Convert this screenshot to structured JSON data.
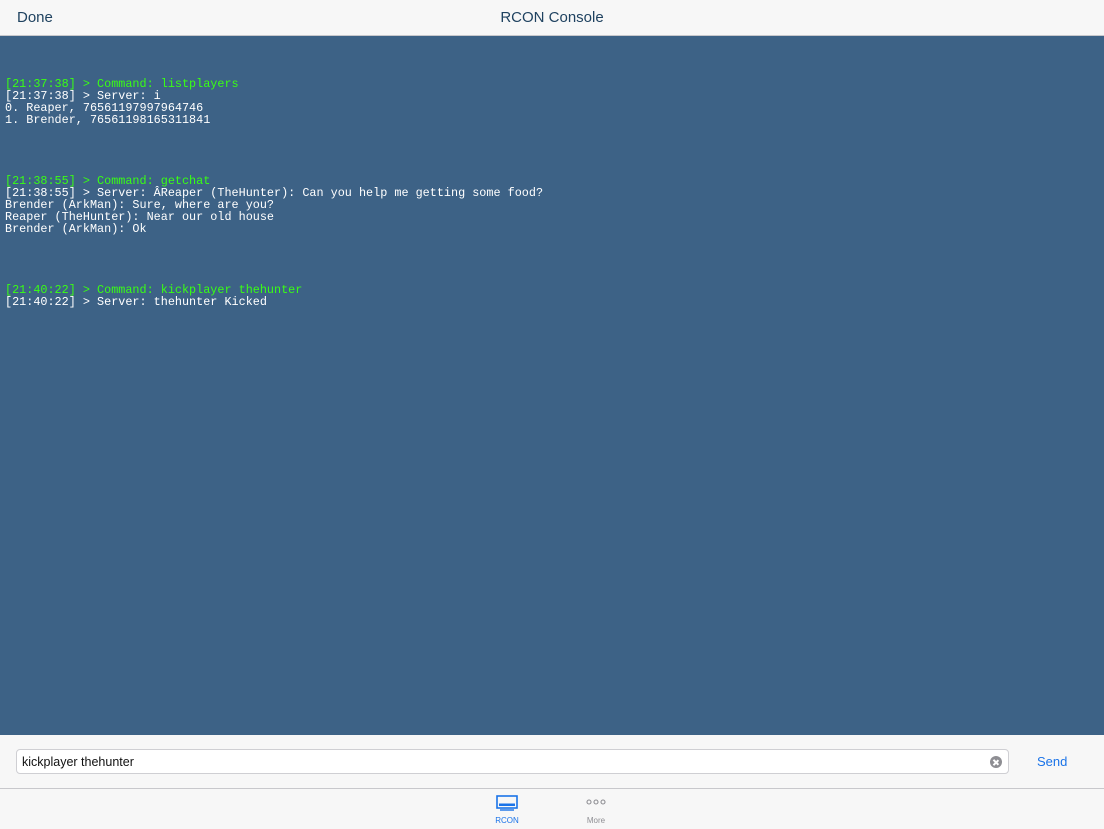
{
  "navbar": {
    "done_label": "Done",
    "title": "RCON Console"
  },
  "console": {
    "lines": [
      {
        "type": "blank",
        "text": ""
      },
      {
        "type": "command",
        "text": "[21:37:38] > Command: listplayers"
      },
      {
        "type": "server",
        "text": "[21:37:38] > Server: i"
      },
      {
        "type": "server",
        "text": "0. Reaper, 76561197997964746"
      },
      {
        "type": "server",
        "text": "1. Brender, 76561198165311841"
      },
      {
        "type": "blank",
        "text": ""
      },
      {
        "type": "blank",
        "text": ""
      },
      {
        "type": "blank",
        "text": ""
      },
      {
        "type": "blank",
        "text": ""
      },
      {
        "type": "command",
        "text": "[21:38:55] > Command: getchat"
      },
      {
        "type": "server",
        "text": "[21:38:55] > Server: ÂReaper (TheHunter): Can you help me getting some food?"
      },
      {
        "type": "server",
        "text": "Brender (ArkMan): Sure, where are you?"
      },
      {
        "type": "server",
        "text": "Reaper (TheHunter): Near our old house"
      },
      {
        "type": "server",
        "text": "Brender (ArkMan): Ok"
      },
      {
        "type": "blank",
        "text": ""
      },
      {
        "type": "blank",
        "text": ""
      },
      {
        "type": "blank",
        "text": ""
      },
      {
        "type": "blank",
        "text": ""
      },
      {
        "type": "command",
        "text": "[21:40:22] > Command: kickplayer thehunter"
      },
      {
        "type": "server",
        "text": "[21:40:22] > Server: thehunter Kicked"
      }
    ],
    "colors": {
      "background": "#3d6286",
      "command": "#39ff14",
      "server": "#ffffff"
    }
  },
  "input": {
    "value": "kickplayer thehunter",
    "placeholder": ""
  },
  "send_label": "Send",
  "tabs": [
    {
      "label": "RCON",
      "icon": "console-icon",
      "active": true
    },
    {
      "label": "More",
      "icon": "more-icon",
      "active": false
    }
  ],
  "accent_color": "#1a73e8"
}
